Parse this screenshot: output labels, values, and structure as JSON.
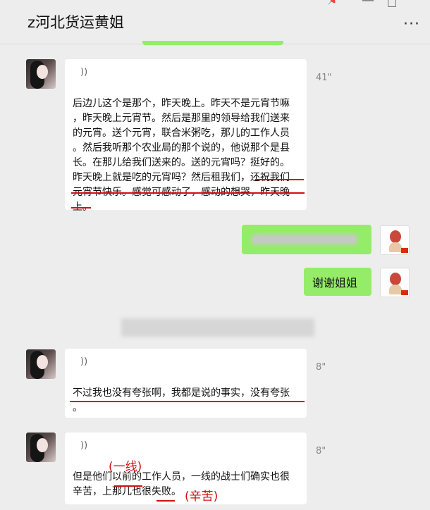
{
  "chat": {
    "title": "z河北货运黄姐",
    "more_label": "···",
    "pin_icon": "pin-icon",
    "minimize_icon": "minimize-icon",
    "maximize_icon": "maximize-icon"
  },
  "messages": [
    {
      "sender": "contact",
      "type": "voice",
      "duration": "41\"",
      "voice_symbol": "))",
      "lines": [
        "后边儿这个是那个，昨天晚上。昨天不是元宵节嘛",
        "，昨天晚上元宵节。然后是那里的领导给我们送来",
        "的元宵。送个元宵，联合米粥吃，那儿的工作人员",
        "。然后我听那个农业局的那个说的，他说那个是县",
        "长。在那儿给我们送来的。送的元宵吗？挺好的。",
        "昨天晚上就是吃的元宵吗？然后租我们，还祝我们",
        "元宵节快乐。感觉可感动了，感动的想哭，昨天晚",
        "上。"
      ]
    },
    {
      "sender": "me",
      "type": "text",
      "text": ""
    },
    {
      "sender": "me",
      "type": "text",
      "text": "谢谢姐姐"
    },
    {
      "sender": "contact",
      "type": "voice",
      "duration": "8\"",
      "voice_symbol": "))",
      "lines": [
        "不过我也没有夸张啊，我都是说的事实，没有夸张",
        "。"
      ]
    },
    {
      "sender": "contact",
      "type": "voice",
      "duration": "8\"",
      "voice_symbol": "))",
      "lines": [
        "但是他们以前的工作人员，一线的战士们确实也很",
        "辛苦，上那儿也很失败。"
      ]
    }
  ],
  "annotations": {
    "above_yiqian": "(一线)",
    "after_shibai": "(辛苦)"
  },
  "colors": {
    "my_bubble": "#95ec69",
    "annotation_red": "#d3100e"
  }
}
